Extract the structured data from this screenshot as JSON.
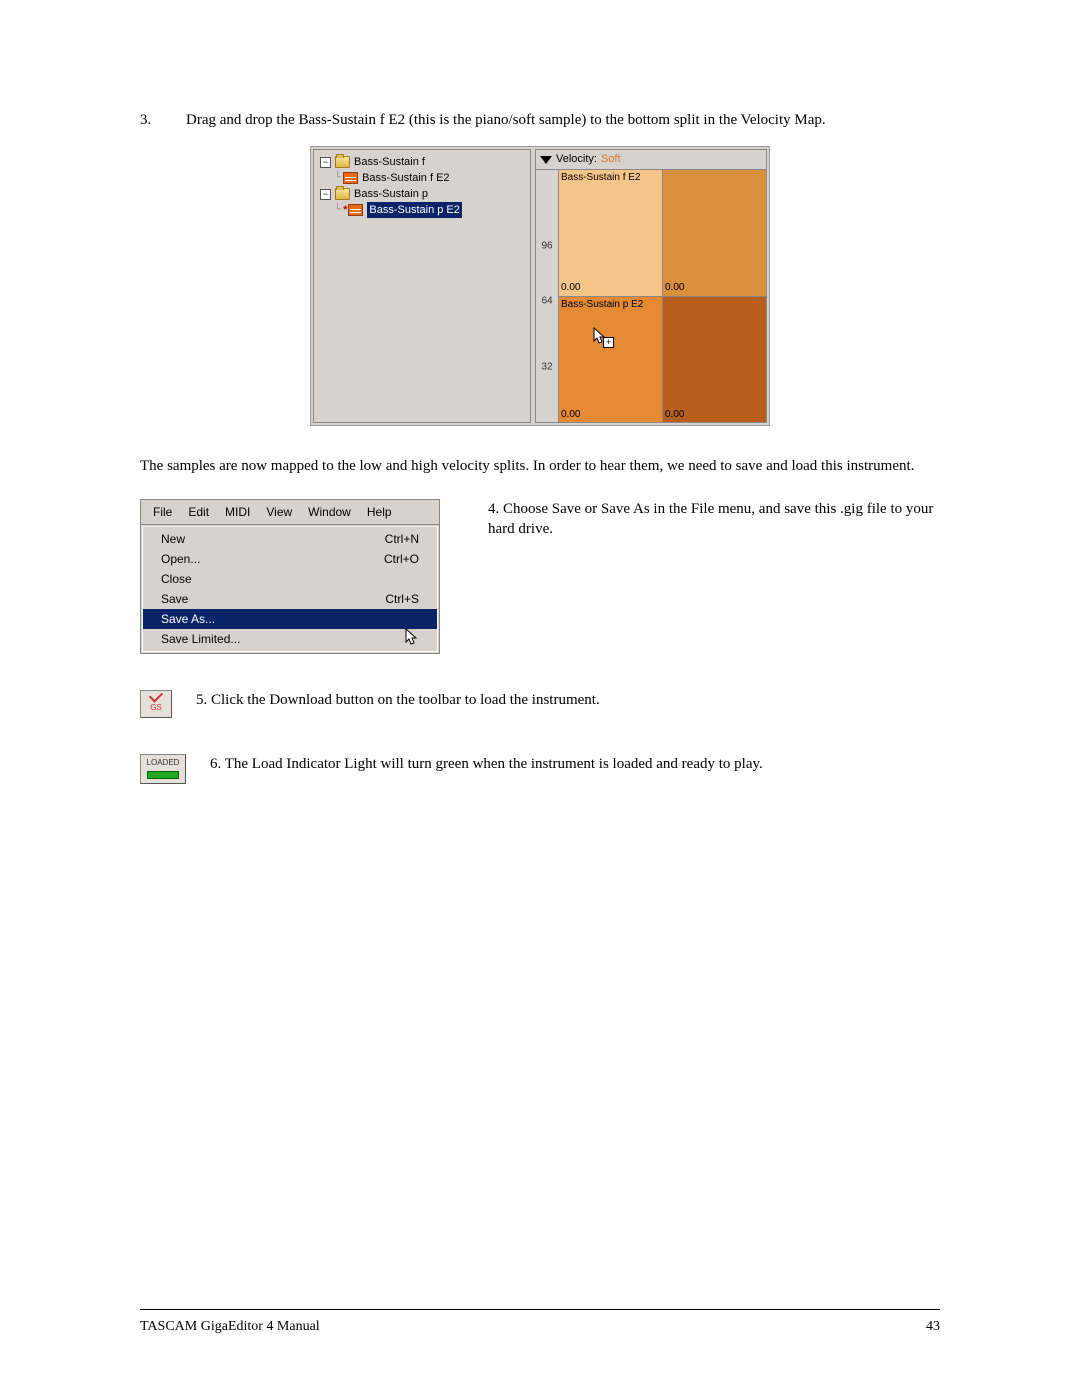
{
  "step3": {
    "num": "3.",
    "text": "Drag and drop the Bass-Sustain f E2 (this is the piano/soft sample) to the bottom split in the Velocity Map."
  },
  "tree": {
    "folder1": "Bass-Sustain f",
    "sample1": "Bass-Sustain f E2",
    "folder2": "Bass-Sustain p",
    "sample2": "Bass-Sustain p E2"
  },
  "velocity": {
    "header_label": "Velocity:",
    "header_value": "Soft",
    "tick96": "96",
    "tick64": "64",
    "tick32": "32",
    "topA_label": "Bass-Sustain f E2",
    "topA_val": "0.00",
    "topB_val": "0.00",
    "botA_label": "Bass-Sustain p E2",
    "botA_val": "0.00",
    "botB_val": "0.00"
  },
  "para_after_fig1": "The samples are now mapped to the low and high velocity splits. In order to hear them, we need to save and load this instrument.",
  "step4_text": "4. Choose Save or Save As in the File menu, and save this .gig file to your hard drive.",
  "menu": {
    "bar": {
      "file": "File",
      "edit": "Edit",
      "midi": "MIDI",
      "view": "View",
      "window": "Window",
      "help": "Help"
    },
    "items": {
      "new": "New",
      "new_sc": "Ctrl+N",
      "open": "Open...",
      "open_sc": "Ctrl+O",
      "close": "Close",
      "save": "Save",
      "save_sc": "Ctrl+S",
      "save_as": "Save As...",
      "save_limited": "Save Limited..."
    }
  },
  "download_btn_label": "GS",
  "step5_text": "5. Click the Download button on the toolbar to load the instrument.",
  "loaded_label": "LOADED",
  "step6_text": "6. The Load Indicator Light will turn green when the instrument is loaded and ready to play.",
  "footer_left": "TASCAM GigaEditor 4 Manual",
  "footer_right": "43"
}
